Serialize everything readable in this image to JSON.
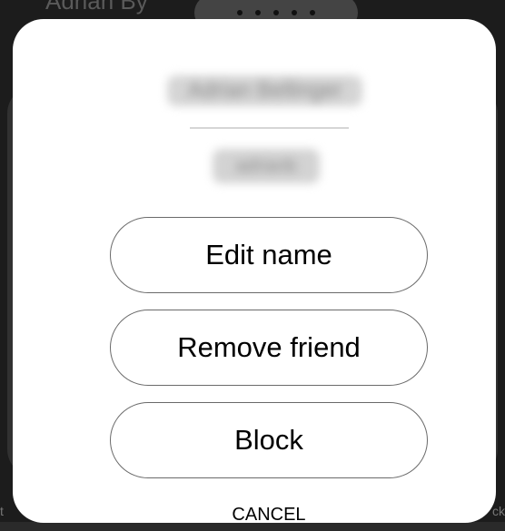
{
  "background": {
    "title": "Adrian By",
    "left_edge": "t",
    "right_edge": "ck"
  },
  "dialog": {
    "display_name": "Adrian Bellinger",
    "username": "adrianb",
    "actions": [
      {
        "label": "Edit name"
      },
      {
        "label": "Remove friend"
      },
      {
        "label": "Block"
      }
    ],
    "cancel_label": "CANCEL"
  },
  "colors": {
    "dialog_bg": "#ffffff",
    "overlay_bg": "#1c1c1c",
    "button_border": "#6a6a6a",
    "text": "#000000"
  }
}
